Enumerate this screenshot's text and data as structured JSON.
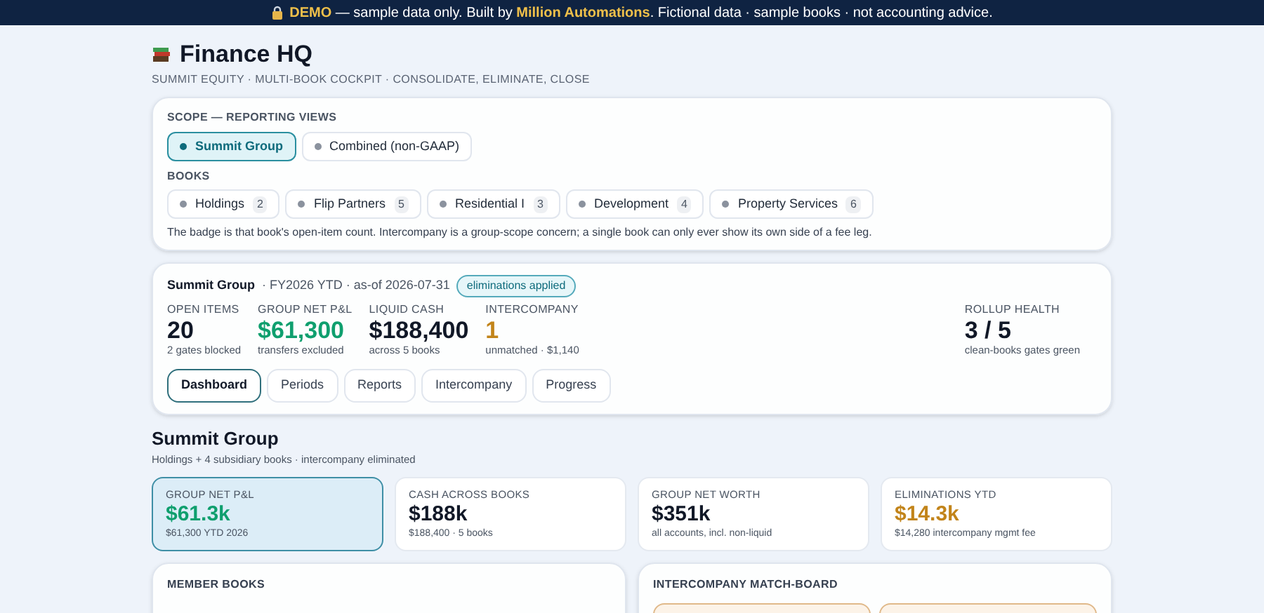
{
  "banner": {
    "text": "DEMO",
    "rest_1": " — sample data only. Built by ",
    "link": "Million Automations",
    "rest_2": ". Fictional data · sample books · not accounting advice."
  },
  "header": {
    "title": "Finance HQ",
    "subtitle": "SUMMIT EQUITY · MULTI-BOOK COCKPIT · CONSOLIDATE, ELIMINATE, CLOSE"
  },
  "scope": {
    "label": "SCOPE — REPORTING VIEWS",
    "views": [
      {
        "label": "Summit Group",
        "selected": true
      },
      {
        "label": "Combined (non-GAAP)",
        "selected": false
      }
    ],
    "books_label": "BOOKS",
    "books": [
      {
        "label": "Holdings",
        "count": "2",
        "selected": false
      },
      {
        "label": "Flip Partners",
        "count": "5",
        "selected": false
      },
      {
        "label": "Residential I",
        "count": "3",
        "selected": false
      },
      {
        "label": "Development",
        "count": "4",
        "selected": false
      },
      {
        "label": "Property Services",
        "count": "6",
        "selected": false
      }
    ],
    "note": "The badge is that book's open-item count. Intercompany is a group-scope concern; a single book can only ever show its own side of a fee leg."
  },
  "summary": {
    "entity": "Summit Group",
    "period": "· FY2026 YTD · as-of 2026-07-31",
    "badge": "eliminations applied",
    "metrics": [
      {
        "label": "OPEN ITEMS",
        "value": "20",
        "note": "2 gates blocked",
        "color": "#111827"
      },
      {
        "label": "GROUP NET P&L",
        "value": "$61,300",
        "note": "transfers excluded",
        "color": "#0f9f6e"
      },
      {
        "label": "LIQUID CASH",
        "value": "$188,400",
        "note": "across 5 books",
        "color": "#111827"
      },
      {
        "label": "INTERCOMPANY",
        "value": "1",
        "note": "unmatched · $1,140",
        "color": "#c2841a"
      }
    ],
    "health": {
      "label": "ROLLUP HEALTH",
      "value": "3 / 5",
      "note": "clean-books gates green"
    },
    "tabs": [
      {
        "label": "Dashboard",
        "selected": true
      },
      {
        "label": "Periods",
        "selected": false
      },
      {
        "label": "Reports",
        "selected": false
      },
      {
        "label": "Intercompany",
        "selected": false
      },
      {
        "label": "Progress",
        "selected": false
      }
    ]
  },
  "section": {
    "title": "Summit Group",
    "subtitle": "Holdings + 4 subsidiary books · intercompany eliminated",
    "kpis": [
      {
        "label": "GROUP NET P&L",
        "value": "$61.3k",
        "note": "$61,300 YTD 2026",
        "color": "#0f9f6e",
        "selected": true
      },
      {
        "label": "CASH ACROSS BOOKS",
        "value": "$188k",
        "note": "$188,400 · 5 books",
        "color": "#111827",
        "selected": false
      },
      {
        "label": "GROUP NET WORTH",
        "value": "$351k",
        "note": "all accounts, incl. non-liquid",
        "color": "#111827",
        "selected": false
      },
      {
        "label": "ELIMINATIONS YTD",
        "value": "$14.3k",
        "note": "$14,280 intercompany mgmt fee",
        "color": "#c2841a",
        "selected": false
      }
    ],
    "panels": [
      {
        "title": "MEMBER BOOKS"
      },
      {
        "title": "INTERCOMPANY MATCH-BOARD"
      }
    ]
  }
}
